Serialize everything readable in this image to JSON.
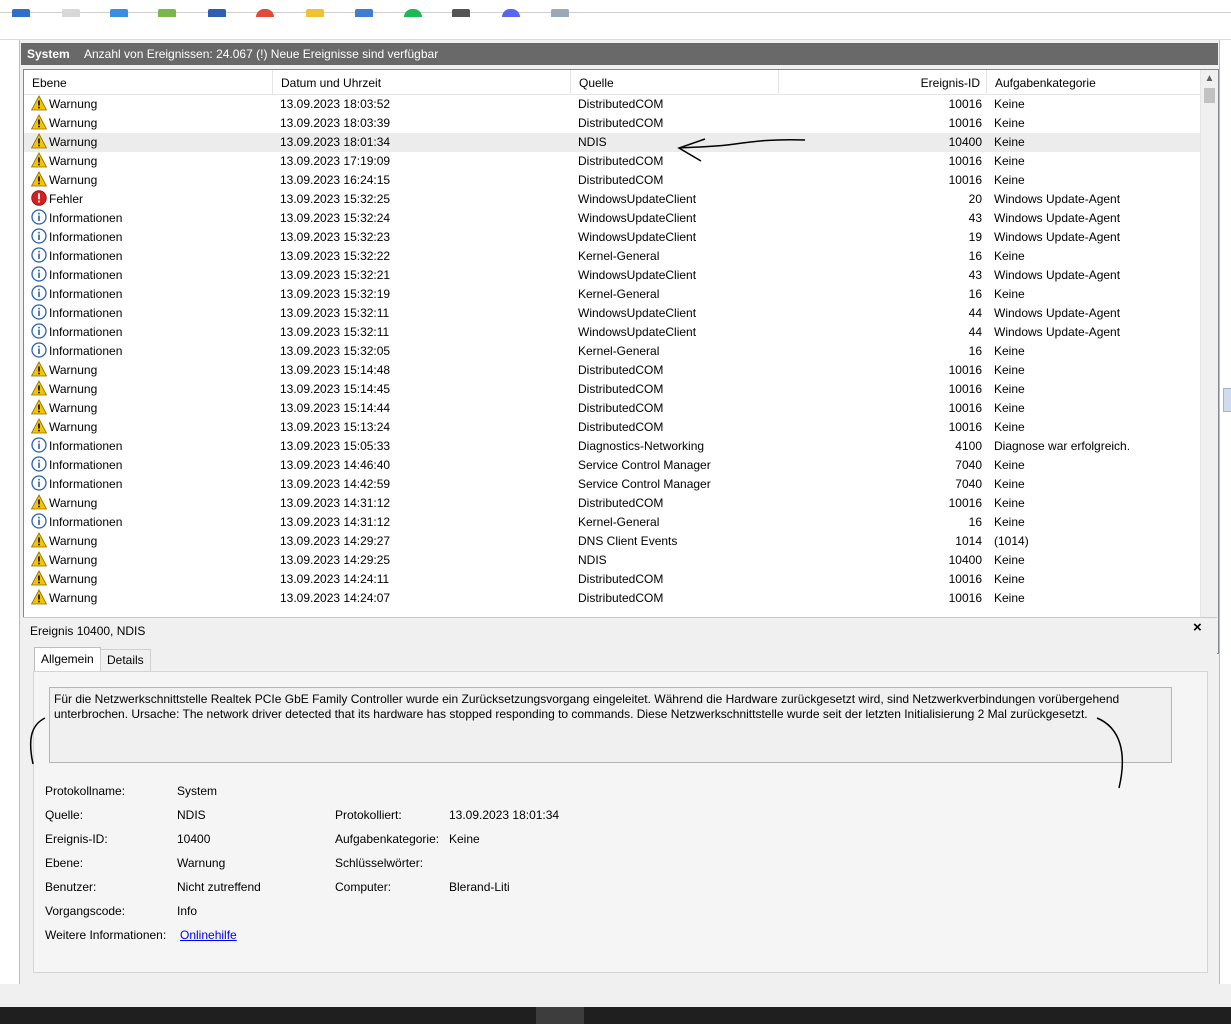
{
  "window": {
    "log_name": "System",
    "event_count_text": "Anzahl von Ereignissen: 24.067 (!) Neue Ereignisse sind verfügbar"
  },
  "columns": [
    "Ebene",
    "Datum und Uhrzeit",
    "Quelle",
    "Ereignis-ID",
    "Aufgabenkategorie"
  ],
  "events": [
    {
      "level": "Warnung",
      "icon": "warning-icon",
      "date": "13.09.2023 18:03:52",
      "source": "DistributedCOM",
      "id": "10016",
      "category": "Keine"
    },
    {
      "level": "Warnung",
      "icon": "warning-icon",
      "date": "13.09.2023 18:03:39",
      "source": "DistributedCOM",
      "id": "10016",
      "category": "Keine"
    },
    {
      "level": "Warnung",
      "icon": "warning-icon",
      "date": "13.09.2023 18:01:34",
      "source": "NDIS",
      "id": "10400",
      "category": "Keine",
      "selected": true
    },
    {
      "level": "Warnung",
      "icon": "warning-icon",
      "date": "13.09.2023 17:19:09",
      "source": "DistributedCOM",
      "id": "10016",
      "category": "Keine"
    },
    {
      "level": "Warnung",
      "icon": "warning-icon",
      "date": "13.09.2023 16:24:15",
      "source": "DistributedCOM",
      "id": "10016",
      "category": "Keine"
    },
    {
      "level": "Fehler",
      "icon": "error-icon",
      "date": "13.09.2023 15:32:25",
      "source": "WindowsUpdateClient",
      "id": "20",
      "category": "Windows Update-Agent"
    },
    {
      "level": "Informationen",
      "icon": "info-icon",
      "date": "13.09.2023 15:32:24",
      "source": "WindowsUpdateClient",
      "id": "43",
      "category": "Windows Update-Agent"
    },
    {
      "level": "Informationen",
      "icon": "info-icon",
      "date": "13.09.2023 15:32:23",
      "source": "WindowsUpdateClient",
      "id": "19",
      "category": "Windows Update-Agent"
    },
    {
      "level": "Informationen",
      "icon": "info-icon",
      "date": "13.09.2023 15:32:22",
      "source": "Kernel-General",
      "id": "16",
      "category": "Keine"
    },
    {
      "level": "Informationen",
      "icon": "info-icon",
      "date": "13.09.2023 15:32:21",
      "source": "WindowsUpdateClient",
      "id": "43",
      "category": "Windows Update-Agent"
    },
    {
      "level": "Informationen",
      "icon": "info-icon",
      "date": "13.09.2023 15:32:19",
      "source": "Kernel-General",
      "id": "16",
      "category": "Keine"
    },
    {
      "level": "Informationen",
      "icon": "info-icon",
      "date": "13.09.2023 15:32:11",
      "source": "WindowsUpdateClient",
      "id": "44",
      "category": "Windows Update-Agent"
    },
    {
      "level": "Informationen",
      "icon": "info-icon",
      "date": "13.09.2023 15:32:11",
      "source": "WindowsUpdateClient",
      "id": "44",
      "category": "Windows Update-Agent"
    },
    {
      "level": "Informationen",
      "icon": "info-icon",
      "date": "13.09.2023 15:32:05",
      "source": "Kernel-General",
      "id": "16",
      "category": "Keine"
    },
    {
      "level": "Warnung",
      "icon": "warning-icon",
      "date": "13.09.2023 15:14:48",
      "source": "DistributedCOM",
      "id": "10016",
      "category": "Keine"
    },
    {
      "level": "Warnung",
      "icon": "warning-icon",
      "date": "13.09.2023 15:14:45",
      "source": "DistributedCOM",
      "id": "10016",
      "category": "Keine"
    },
    {
      "level": "Warnung",
      "icon": "warning-icon",
      "date": "13.09.2023 15:14:44",
      "source": "DistributedCOM",
      "id": "10016",
      "category": "Keine"
    },
    {
      "level": "Warnung",
      "icon": "warning-icon",
      "date": "13.09.2023 15:13:24",
      "source": "DistributedCOM",
      "id": "10016",
      "category": "Keine"
    },
    {
      "level": "Informationen",
      "icon": "info-icon",
      "date": "13.09.2023 15:05:33",
      "source": "Diagnostics-Networking",
      "id": "4100",
      "category": "Diagnose war erfolgreich."
    },
    {
      "level": "Informationen",
      "icon": "info-icon",
      "date": "13.09.2023 14:46:40",
      "source": "Service Control Manager",
      "id": "7040",
      "category": "Keine"
    },
    {
      "level": "Informationen",
      "icon": "info-icon",
      "date": "13.09.2023 14:42:59",
      "source": "Service Control Manager",
      "id": "7040",
      "category": "Keine"
    },
    {
      "level": "Warnung",
      "icon": "warning-icon",
      "date": "13.09.2023 14:31:12",
      "source": "DistributedCOM",
      "id": "10016",
      "category": "Keine"
    },
    {
      "level": "Informationen",
      "icon": "info-icon",
      "date": "13.09.2023 14:31:12",
      "source": "Kernel-General",
      "id": "16",
      "category": "Keine"
    },
    {
      "level": "Warnung",
      "icon": "warning-icon",
      "date": "13.09.2023 14:29:27",
      "source": "DNS Client Events",
      "id": "1014",
      "category": "(1014)"
    },
    {
      "level": "Warnung",
      "icon": "warning-icon",
      "date": "13.09.2023 14:29:25",
      "source": "NDIS",
      "id": "10400",
      "category": "Keine"
    },
    {
      "level": "Warnung",
      "icon": "warning-icon",
      "date": "13.09.2023 14:24:11",
      "source": "DistributedCOM",
      "id": "10016",
      "category": "Keine"
    },
    {
      "level": "Warnung",
      "icon": "warning-icon",
      "date": "13.09.2023 14:24:07",
      "source": "DistributedCOM",
      "id": "10016",
      "category": "Keine"
    }
  ],
  "detail": {
    "title": "Ereignis 10400, NDIS",
    "close": "×",
    "tabs": [
      "Allgemein",
      "Details"
    ],
    "message_line1": "Für die Netzwerkschnittstelle Realtek PCIe GbE Family Controller wurde ein Zurücksetzungsvorgang eingeleitet. Während die Hardware zurückgesetzt wird, sind Netzwerkverbindungen vorübergehend",
    "message_line2": "unterbrochen. Ursache: The network driver detected that its hardware has stopped responding to commands. Diese Netzwerkschnittstelle wurde seit der letzten Initialisierung 2 Mal zurückgesetzt.",
    "labels": {
      "protokollname": "Protokollname:",
      "quelle": "Quelle:",
      "ereignis_id": "Ereignis-ID:",
      "ebene": "Ebene:",
      "benutzer": "Benutzer:",
      "vorgangscode": "Vorgangscode:",
      "weitere": "Weitere Informationen:",
      "protokolliert": "Protokolliert:",
      "aufgabenkategorie": "Aufgabenkategorie:",
      "schluesselwoerter": "Schlüsselwörter:",
      "computer": "Computer:"
    },
    "values": {
      "protokollname": "System",
      "quelle": "NDIS",
      "ereignis_id": "10400",
      "ebene": "Warnung",
      "benutzer": "Nicht zutreffend",
      "vorgangscode": "Info",
      "weitere": "Onlinehilfe",
      "protokolliert": "13.09.2023 18:01:34",
      "aufgabenkategorie": "Keine",
      "schluesselwoerter": "",
      "computer": "Blerand-Liti"
    }
  },
  "colors": {
    "titlebar": "#696969",
    "selected_row": "#ececec",
    "warning": "#f5c400",
    "error": "#d42020",
    "info": "#2b5fab",
    "link": "#0000ee",
    "taskbar": "#1f1f1f"
  }
}
